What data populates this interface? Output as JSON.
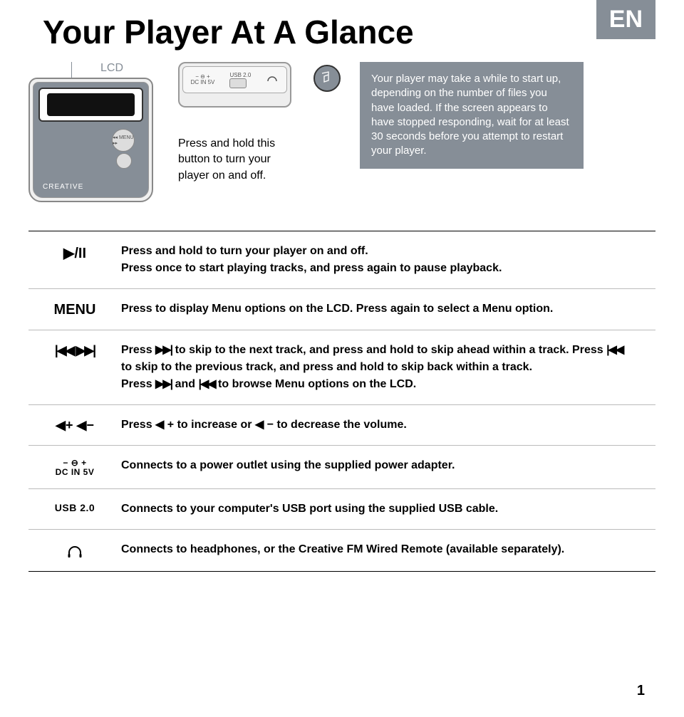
{
  "header": {
    "title": "Your Player At A Glance",
    "lang": "EN"
  },
  "top": {
    "lcd_label": "LCD",
    "brand": "CREATIVE",
    "press_hold": "Press and hold this button to turn your player on and off.",
    "note": "Your player may take a while to start up, depending on the number of files you have loaded. If the screen appears to have stopped responding, wait for at least 30 seconds before you attempt to restart your player.",
    "top_ports": {
      "dc": "DC IN 5V",
      "usb": "USB 2.0"
    }
  },
  "rows": {
    "play": {
      "line1": "Press and hold to turn your player on and off.",
      "line2": "Press once to start playing tracks, and press again to pause playback."
    },
    "menu": {
      "label": "MENU",
      "text": "Press to display Menu options on the LCD. Press again to select a Menu option."
    },
    "skip": {
      "p1a": "Press ",
      "p1b": " to skip to the next track, and press and hold to skip ahead within a track. Press ",
      "p1c": " to skip to the previous track, and press and hold to skip back within a track.",
      "p2a": "Press ",
      "p2b": " and ",
      "p2c": " to browse Menu options on the LCD."
    },
    "volume": {
      "a": "Press ",
      "b": " to increase or ",
      "c": " to decrease the volume."
    },
    "dc": {
      "icon_top": "− ⊖ +",
      "icon_bottom": "DC IN 5V",
      "text": "Connects to a power outlet using the supplied power adapter."
    },
    "usb": {
      "icon": "USB 2.0",
      "text": "Connects to your computer's USB port using the supplied USB cable."
    },
    "headphones": {
      "text": "Connects to headphones, or the Creative FM Wired Remote (available separately)."
    }
  },
  "page_number": "1"
}
